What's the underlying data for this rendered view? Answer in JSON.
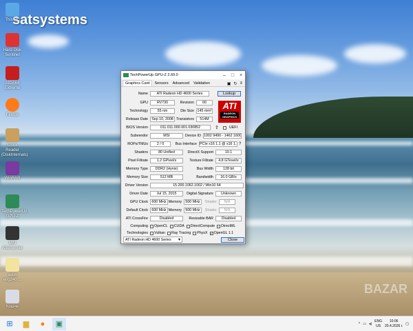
{
  "desktop": {
    "brand": "satsystems",
    "watermark": "BAZAR",
    "icons": [
      {
        "label": "This PC",
        "color": "#5aa9e6"
      },
      {
        "label": "Hard Disk Sentinel",
        "color": "#d33"
      },
      {
        "label": "AIDA64 Extreme",
        "color": "#c41e1e"
      },
      {
        "label": "Firefox",
        "color": "#ff7a18"
      },
      {
        "label": "Linux Reader (DiskInternals)",
        "color": "#c8a060"
      },
      {
        "label": "WinRAR",
        "color": "#7a3aa0"
      },
      {
        "label": "TechPowerUp GPU-Z",
        "color": "#2e8b57"
      },
      {
        "label": "MSI Afterburner",
        "color": "#333"
      },
      {
        "label": "asus eng240 ...",
        "color": "#f3e3a0"
      },
      {
        "label": "Кошче",
        "color": "#d8dde5"
      }
    ]
  },
  "window": {
    "title": "TechPowerUp GPU-Z 2.69.0",
    "tabs": [
      "Graphics Card",
      "Sensors",
      "Advanced",
      "Validation"
    ],
    "lookup_label": "Lookup",
    "logo": {
      "brand": "ATI",
      "sub": "RADEON GRAPHICS"
    },
    "uefi_label": "UEFI",
    "fields": {
      "name": {
        "label": "Name",
        "value": "ATI Radeon HD 4600 Series"
      },
      "gpu": {
        "label": "GPU",
        "value": "RV730"
      },
      "revision": {
        "label": "Revision",
        "value": "00"
      },
      "technology": {
        "label": "Technology",
        "value": "55 nm"
      },
      "die_size": {
        "label": "Die Size",
        "value": "145 mm²"
      },
      "release_date": {
        "label": "Release Date",
        "value": "Sep 10, 2008"
      },
      "transistors": {
        "label": "Transistors",
        "value": "514M"
      },
      "bios_version": {
        "label": "BIOS Version",
        "value": "011.011.000.001.030852"
      },
      "subvendor": {
        "label": "Subvendor",
        "value": "MSI"
      },
      "device_id": {
        "label": "Device ID",
        "value": "1002 9490 - 1462 1600"
      },
      "rops_tmus": {
        "label": "ROPs/TMUs",
        "value": "2 / 0"
      },
      "bus_interface": {
        "label": "Bus Interface",
        "value": "PCIe x16 1.1 @ x16 1.1"
      },
      "shaders": {
        "label": "Shaders",
        "value": "80 Unified"
      },
      "directx": {
        "label": "DirectX Support",
        "value": "10.1"
      },
      "pixel_fillrate": {
        "label": "Pixel Fillrate",
        "value": "1.2 GPixel/s"
      },
      "texture_fillrate": {
        "label": "Texture Fillrate",
        "value": "4.8 GTexel/s"
      },
      "memory_type": {
        "label": "Memory Type",
        "value": "DDR2 (Hynix)"
      },
      "bus_width": {
        "label": "Bus Width",
        "value": "128 bit"
      },
      "memory_size": {
        "label": "Memory Size",
        "value": "512 MB"
      },
      "bandwidth": {
        "label": "Bandwidth",
        "value": "16.0 GB/s"
      },
      "driver_version": {
        "label": "Driver Version",
        "value": "15.200.1062.1002 / Win10 64"
      },
      "driver_date": {
        "label": "Driver Date",
        "value": "Jul 15, 2015"
      },
      "digital_signature": {
        "label": "Digital Signature",
        "value": "Unknown"
      },
      "gpu_clock": {
        "label": "GPU Clock",
        "value": "600 MHz",
        "mem_label": "Memory",
        "mem_value": "500 MHz",
        "shader_label": "Shader",
        "shader_value": "N/A"
      },
      "default_clock": {
        "label": "Default Clock",
        "value": "600 MHz",
        "mem_label": "Memory",
        "mem_value": "500 MHz",
        "shader_label": "Shader",
        "shader_value": "N/A"
      },
      "crossfire": {
        "label": "ATI CrossFire",
        "value": "Disabled"
      },
      "resizable_bar": {
        "label": "Resizable BAR",
        "value": "Disabled"
      }
    },
    "computing": {
      "label": "Computing",
      "items": [
        {
          "name": "OpenCL",
          "checked": false
        },
        {
          "name": "CUDA",
          "checked": false
        },
        {
          "name": "DirectCompute",
          "checked": false
        },
        {
          "name": "DirectML",
          "checked": false
        }
      ]
    },
    "technologies": {
      "label": "Technologies",
      "items": [
        {
          "name": "Vulkan",
          "checked": false
        },
        {
          "name": "Ray Tracing",
          "checked": false
        },
        {
          "name": "PhysX",
          "checked": false
        },
        {
          "name": "OpenGL 1.1",
          "checked": true
        }
      ]
    },
    "footer": {
      "selected": "ATI Radeon HD 4600 Series",
      "close_label": "Close"
    }
  },
  "taskbar": {
    "tray": {
      "lang_top": "ENG",
      "lang_bottom": "US",
      "time": "10:06",
      "date": "20.4.2026 г."
    }
  }
}
